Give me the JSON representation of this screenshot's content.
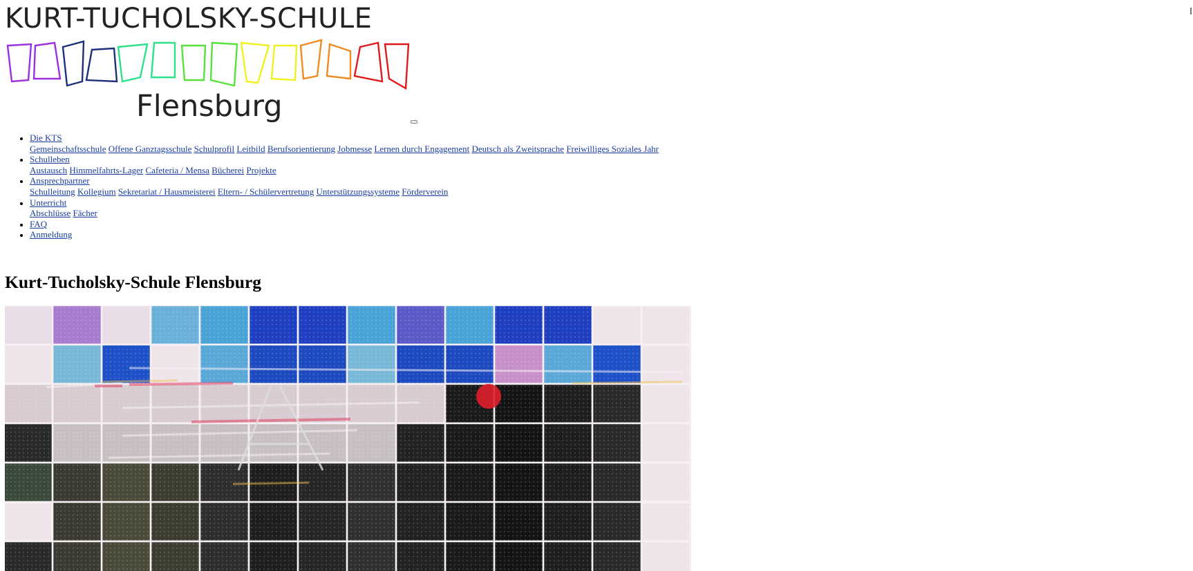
{
  "logo": {
    "title": "KURT-TUCHOLSKY-SCHULE",
    "subtitle": "Flensburg",
    "stripe_colors": [
      "#9b30e0",
      "#9b30e0",
      "#1b2f7a",
      "#1b2f7a",
      "#2de08a",
      "#2de08a",
      "#5ae03a",
      "#5ae03a",
      "#f0f020",
      "#f0f020",
      "#f08a20",
      "#f08a20",
      "#e01a1a",
      "#e01a1a"
    ]
  },
  "nav": {
    "items": [
      {
        "label": "Die KTS",
        "sub": [
          "Gemeinschaftsschule",
          "Offene Ganztagsschule",
          "Schulprofil",
          "Leitbild",
          "Berufsorientierung",
          "Jobmesse",
          "Lernen durch Engagement",
          "Deutsch als Zweitsprache",
          "Freiwilliges Soziales Jahr"
        ]
      },
      {
        "label": "Schulleben",
        "sub": [
          "Austausch",
          "Himmelfahrts-Lager",
          "Cafeteria / Mensa",
          "Bücherei",
          "Projekte"
        ]
      },
      {
        "label": "Ansprechpartner",
        "sub": [
          "Schulleitung",
          "Kollegium",
          "Sekretariat / Hausmeisterei",
          "Eltern- / Schülervertretung",
          "Unterstützungssysteme",
          "Förderverein"
        ]
      },
      {
        "label": "Unterricht",
        "sub": [
          "Abschlüsse",
          "Fächer"
        ]
      },
      {
        "label": "FAQ",
        "sub": []
      },
      {
        "label": "Anmeldung",
        "sub": []
      }
    ]
  },
  "page": {
    "title": "Kurt-Tucholsky-Schule Flensburg"
  }
}
